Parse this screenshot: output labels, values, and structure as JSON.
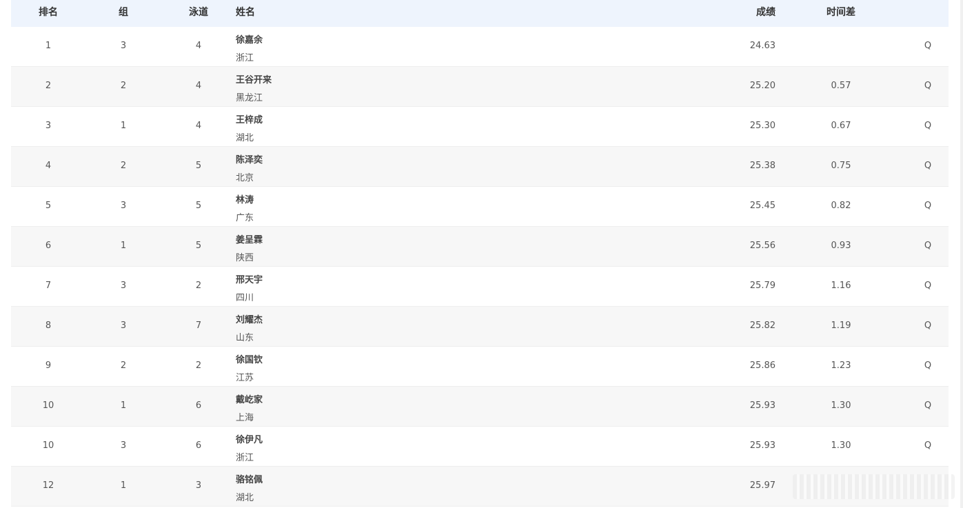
{
  "table": {
    "headers": {
      "rank": "排名",
      "group": "组",
      "lane": "泳道",
      "name": "姓名",
      "result": "成绩",
      "diff": "时间差"
    },
    "rows": [
      {
        "rank": "1",
        "group": "3",
        "lane": "4",
        "name": "徐嘉余",
        "team": "浙江",
        "result": "24.63",
        "diff": "",
        "q": "Q"
      },
      {
        "rank": "2",
        "group": "2",
        "lane": "4",
        "name": "王谷开来",
        "team": "黑龙江",
        "result": "25.20",
        "diff": "0.57",
        "q": "Q"
      },
      {
        "rank": "3",
        "group": "1",
        "lane": "4",
        "name": "王梓成",
        "team": "湖北",
        "result": "25.30",
        "diff": "0.67",
        "q": "Q"
      },
      {
        "rank": "4",
        "group": "2",
        "lane": "5",
        "name": "陈泽奕",
        "team": "北京",
        "result": "25.38",
        "diff": "0.75",
        "q": "Q"
      },
      {
        "rank": "5",
        "group": "3",
        "lane": "5",
        "name": "林涛",
        "team": "广东",
        "result": "25.45",
        "diff": "0.82",
        "q": "Q"
      },
      {
        "rank": "6",
        "group": "1",
        "lane": "5",
        "name": "姜呈霖",
        "team": "陕西",
        "result": "25.56",
        "diff": "0.93",
        "q": "Q"
      },
      {
        "rank": "7",
        "group": "3",
        "lane": "2",
        "name": "邢天宇",
        "team": "四川",
        "result": "25.79",
        "diff": "1.16",
        "q": "Q"
      },
      {
        "rank": "8",
        "group": "3",
        "lane": "7",
        "name": "刘耀杰",
        "team": "山东",
        "result": "25.82",
        "diff": "1.19",
        "q": "Q"
      },
      {
        "rank": "9",
        "group": "2",
        "lane": "2",
        "name": "徐国钦",
        "team": "江苏",
        "result": "25.86",
        "diff": "1.23",
        "q": "Q"
      },
      {
        "rank": "10",
        "group": "1",
        "lane": "6",
        "name": "戴屹家",
        "team": "上海",
        "result": "25.93",
        "diff": "1.30",
        "q": "Q"
      },
      {
        "rank": "10",
        "group": "3",
        "lane": "6",
        "name": "徐伊凡",
        "team": "浙江",
        "result": "25.93",
        "diff": "1.30",
        "q": "Q"
      },
      {
        "rank": "12",
        "group": "1",
        "lane": "3",
        "name": "骆铭佩",
        "team": "湖北",
        "result": "25.97",
        "diff": "",
        "q": ""
      }
    ]
  }
}
